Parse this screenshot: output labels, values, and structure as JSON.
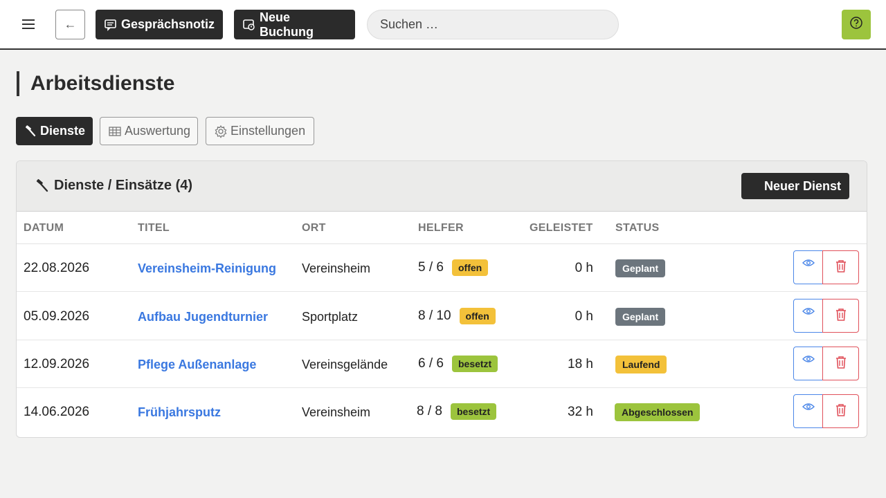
{
  "topbar": {
    "note_label": "Gesprächsnotiz",
    "booking_label": "Neue Buchung",
    "search_placeholder": "Suchen …"
  },
  "page": {
    "title": "Arbeitsdienste"
  },
  "tabs": [
    {
      "label": "Dienste",
      "active": true,
      "icon": "hammer-icon"
    },
    {
      "label": "Auswertung",
      "active": false,
      "icon": "table-icon"
    },
    {
      "label": "Einstellungen",
      "active": false,
      "icon": "gear-icon"
    }
  ],
  "card": {
    "title": "Dienste / Einsätze (4)",
    "new_button": "Neuer Dienst"
  },
  "table": {
    "headers": [
      "DATUM",
      "TITEL",
      "ORT",
      "HELFER",
      "GELEISTET",
      "STATUS"
    ],
    "rows": [
      {
        "datum": "22.08.2026",
        "titel": "Vereinsheim-Reinigung",
        "ort": "Vereinsheim",
        "helfer": "5 / 6",
        "helfer_badge": "offen",
        "geleistet": "0 h",
        "status": "Geplant"
      },
      {
        "datum": "05.09.2026",
        "titel": "Aufbau Jugendturnier",
        "ort": "Sportplatz",
        "helfer": "8 / 10",
        "helfer_badge": "offen",
        "geleistet": "0 h",
        "status": "Geplant"
      },
      {
        "datum": "12.09.2026",
        "titel": "Pflege Außenanlage",
        "ort": "Vereinsgelände",
        "helfer": "6 / 6",
        "helfer_badge": "besetzt",
        "geleistet": "18 h",
        "status": "Laufend"
      },
      {
        "datum": "14.06.2026",
        "titel": "Frühjahrsputz",
        "ort": "Vereinsheim",
        "helfer": "8 / 8",
        "helfer_badge": "besetzt",
        "geleistet": "32 h",
        "status": "Abgeschlossen"
      }
    ]
  },
  "colors": {
    "badge_offen": "#f3c13a",
    "badge_besetzt": "#9cc43d",
    "status_geplant": "#6c757d",
    "status_laufend": "#f3c13a",
    "status_abgeschlossen": "#9cc43d",
    "link": "#3a78e0",
    "accent_help": "#9cc43d"
  }
}
